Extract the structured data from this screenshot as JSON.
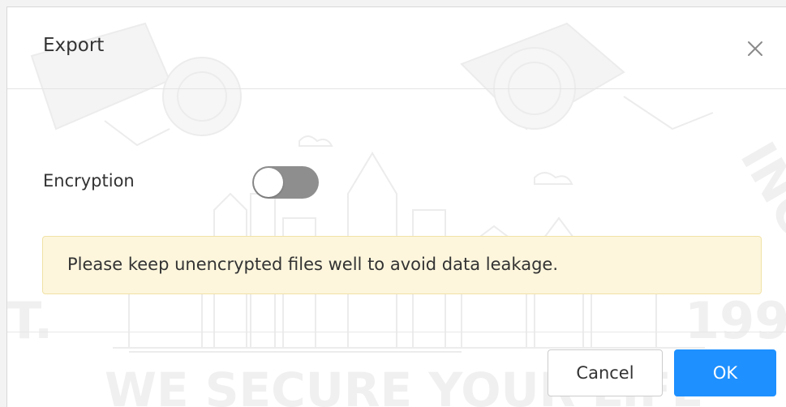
{
  "dialog": {
    "title": "Export",
    "close_icon": "close-icon"
  },
  "encryption": {
    "label": "Encryption",
    "enabled": false
  },
  "warning": {
    "text": "Please keep unencrypted files well to avoid data leakage."
  },
  "buttons": {
    "cancel_label": "Cancel",
    "ok_label": "OK"
  },
  "colors": {
    "accent": "#1e90ff",
    "warning_bg": "#fdf6dd",
    "toggle_off": "#8e8e8e"
  }
}
